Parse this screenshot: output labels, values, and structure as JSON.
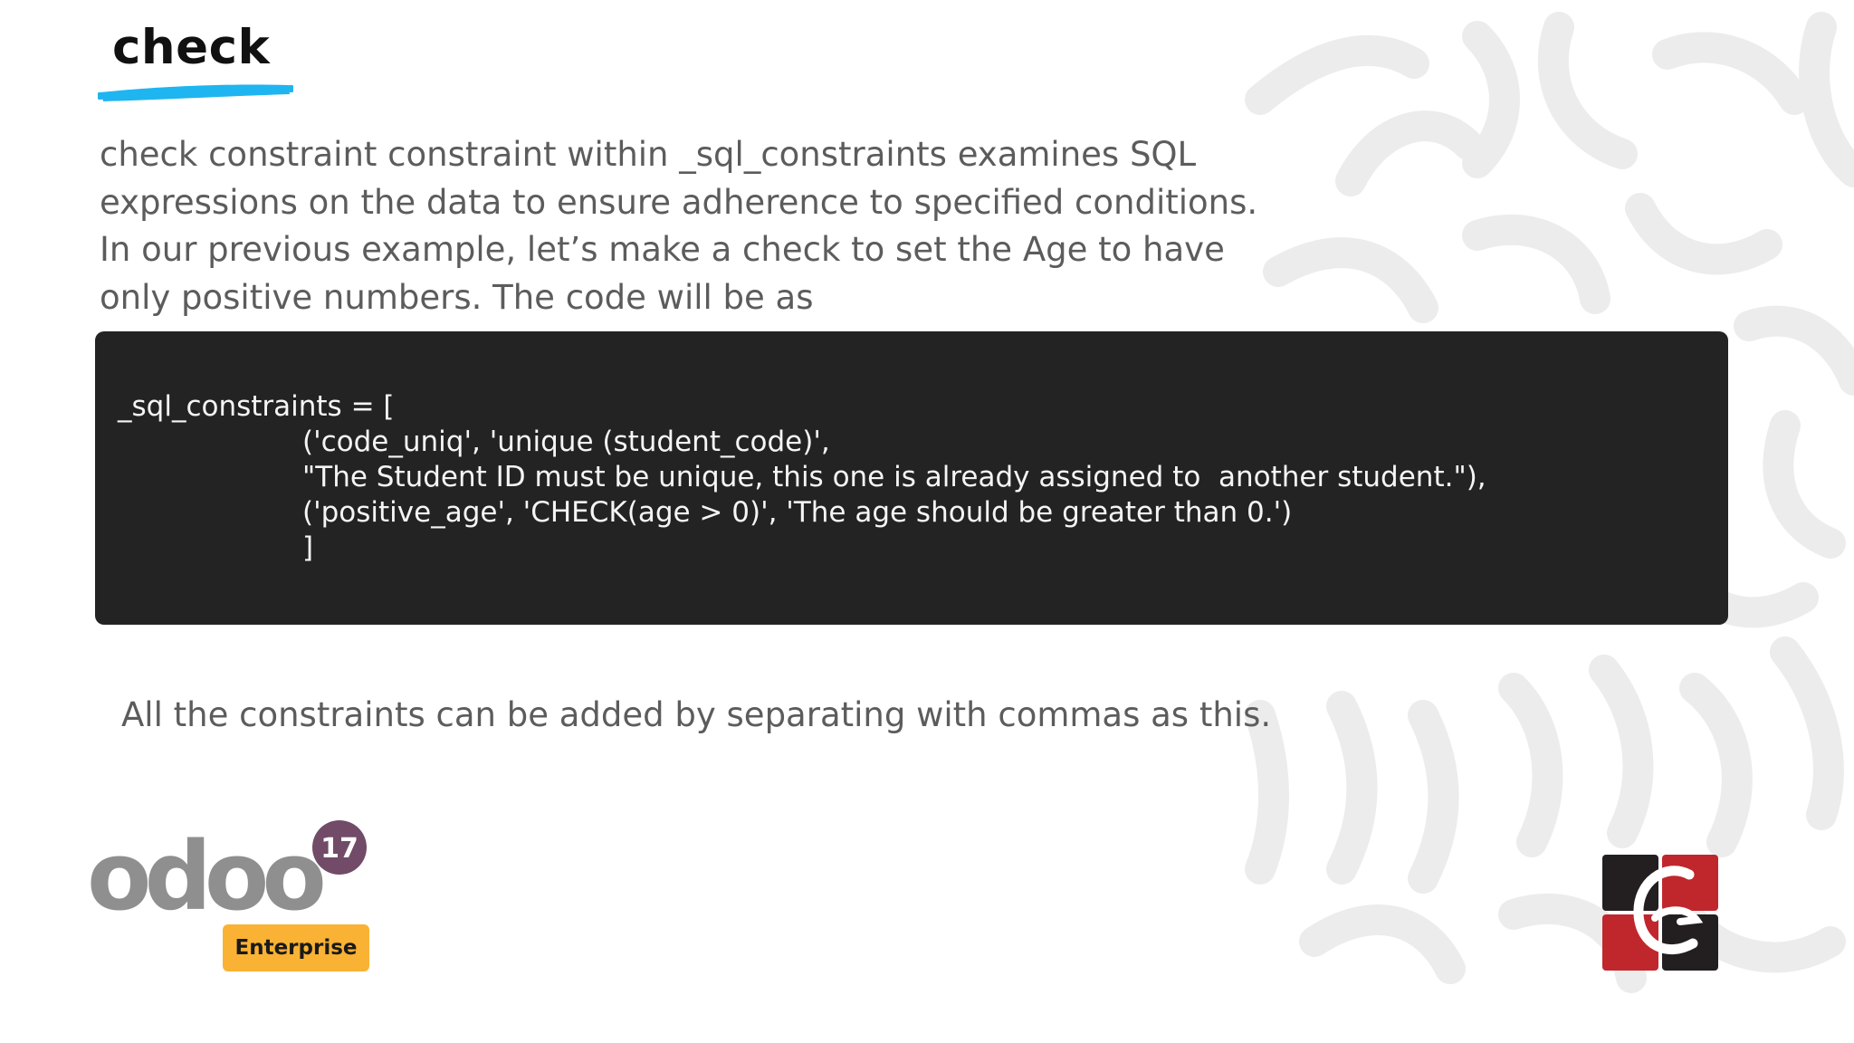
{
  "slide": {
    "title": "check",
    "intro": "check constraint constraint within _sql_constraints examines SQL expressions on the data to ensure adherence to specified conditions. In our previous example, let’s make a check to set the Age to have only positive numbers. The code will be as",
    "code_lines": [
      "_sql_constraints = [",
      "('code_uniq', 'unique (student_code)',",
      "\"The Student ID must be unique, this one is already assigned to  another student.\"),",
      "('positive_age', 'CHECK(age > 0)', 'The age should be greater than 0.')",
      "]"
    ],
    "footnote": "All the constraints can be added by separating with commas as this."
  },
  "logos": {
    "odoo_wordmark": "odoo",
    "odoo_version": "17",
    "edition": "Enterprise"
  },
  "colors": {
    "underline": "#1fb5f0",
    "code_bg": "#232323",
    "odoo_purple": "#714b67",
    "odoo_gray": "#8f8f8f",
    "badge": "#f9b233",
    "brand_red": "#c0272d",
    "brand_dark": "#231f20"
  }
}
